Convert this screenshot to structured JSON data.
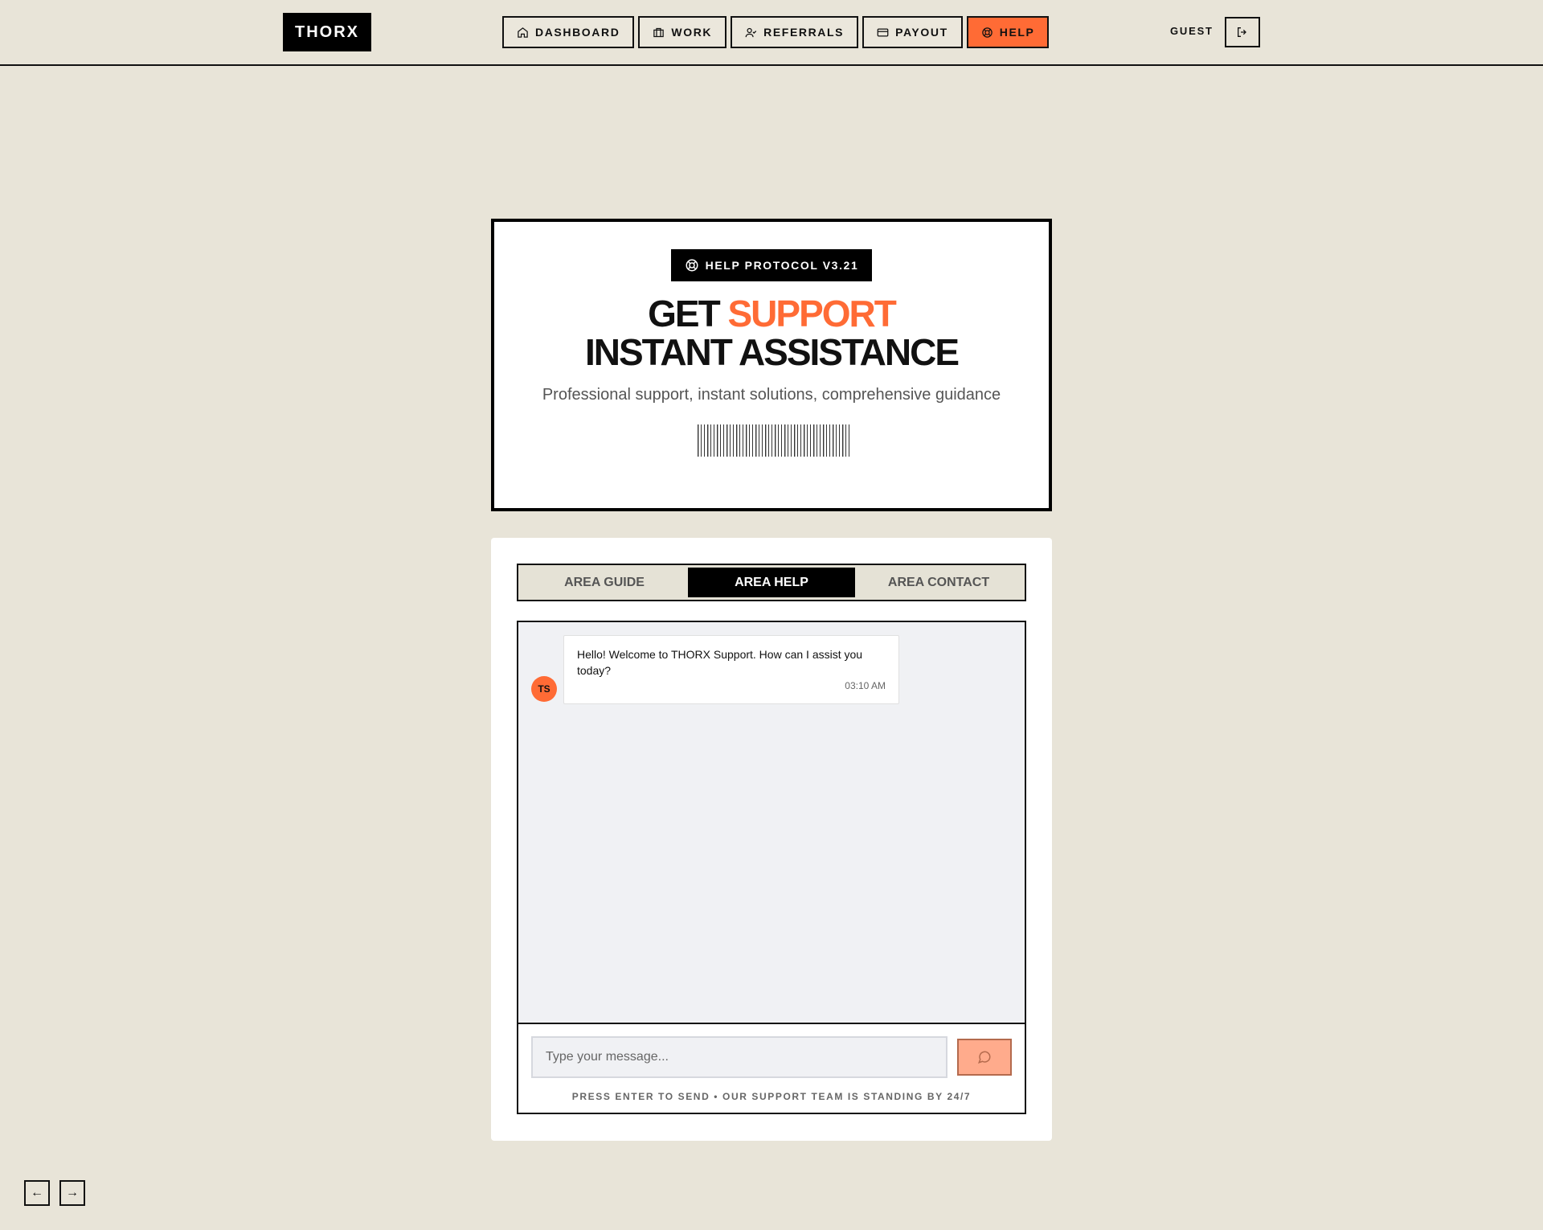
{
  "header": {
    "logo": "THORX",
    "nav": [
      {
        "label": "DASHBOARD",
        "icon": "home-icon",
        "active": false
      },
      {
        "label": "WORK",
        "icon": "briefcase-icon",
        "active": false
      },
      {
        "label": "REFERRALS",
        "icon": "user-check-icon",
        "active": false
      },
      {
        "label": "PAYOUT",
        "icon": "credit-card-icon",
        "active": false
      },
      {
        "label": "HELP",
        "icon": "lifebuoy-icon",
        "active": true
      }
    ],
    "user_label": "GUEST",
    "logout_icon": "logout-icon"
  },
  "hero": {
    "badge": "HELP PROTOCOL V3.21",
    "title_part1": "GET ",
    "title_accent": "SUPPORT",
    "title_line2": "INSTANT ASSISTANCE",
    "subtitle": "Professional support, instant solutions, comprehensive guidance"
  },
  "tabs": [
    {
      "label": "AREA GUIDE",
      "active": false
    },
    {
      "label": "AREA HELP",
      "active": true
    },
    {
      "label": "AREA CONTACT",
      "active": false
    }
  ],
  "chat": {
    "messages": [
      {
        "avatar": "TS",
        "text": "Hello! Welcome to THORX Support. How can I assist you today?",
        "time": "03:10 AM"
      }
    ],
    "input_placeholder": "Type your message...",
    "send_icon": "message-circle-icon",
    "hint": "PRESS ENTER TO SEND • OUR SUPPORT TEAM IS STANDING BY 24/7"
  },
  "pager": {
    "prev": "←",
    "next": "→"
  },
  "colors": {
    "background": "#e8e4d8",
    "accent": "#ff6b35",
    "ink": "#000000"
  }
}
